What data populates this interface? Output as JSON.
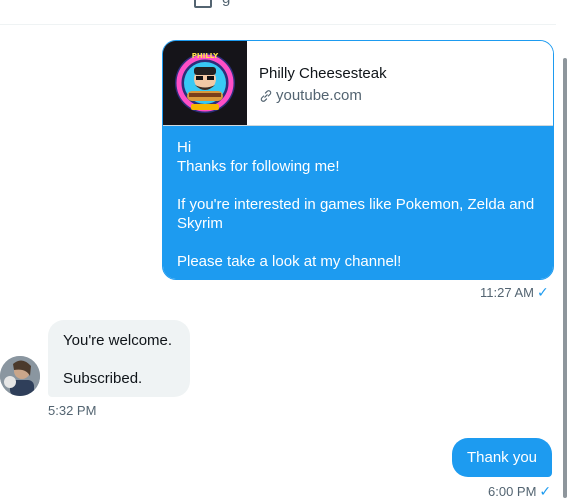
{
  "header": {
    "partial_label": "g"
  },
  "messages": {
    "card": {
      "title": "Philly Cheesesteak",
      "domain": "youtube.com",
      "thumbnail_text": "PHILLY"
    },
    "outgoing_1": {
      "lines": [
        "Hi",
        "Thanks for following me!",
        "If you're interested in games like Pokemon, Zelda and Skyrim",
        "Please take a look at my channel!"
      ],
      "time": "11:27 AM"
    },
    "incoming_1": {
      "lines": [
        "You're welcome.",
        "Subscribed."
      ],
      "time": "5:32 PM"
    },
    "outgoing_2": {
      "text": "Thank you",
      "time": "6:00 PM"
    }
  },
  "colors": {
    "accent": "#1d9bf0",
    "bubble_in": "#eff3f4",
    "muted": "#536471"
  },
  "icons": {
    "link": "link-icon",
    "read_receipt": "checkmark-icon"
  }
}
